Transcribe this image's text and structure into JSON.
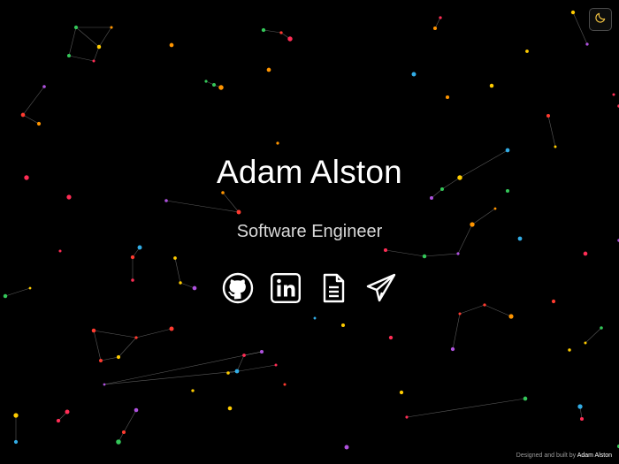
{
  "profile": {
    "name": "Adam Alston",
    "title": "Software Engineer"
  },
  "social_links": [
    {
      "icon": "github-icon",
      "label": "GitHub"
    },
    {
      "icon": "linkedin-icon",
      "label": "LinkedIn"
    },
    {
      "icon": "resume-document-icon",
      "label": "Resume"
    },
    {
      "icon": "paper-plane-icon",
      "label": "Contact"
    }
  ],
  "theme_toggle": {
    "icon": "moon-icon",
    "label": "Toggle theme",
    "accent_color": "#f5c542"
  },
  "footer": {
    "prefix": "Designed and built by",
    "author": "Adam Alston"
  },
  "background": {
    "color": "#000000",
    "particle_colors": [
      "#ff3b30",
      "#ff9500",
      "#ffcc00",
      "#34c759",
      "#32ade6",
      "#af52de",
      "#ff2d55"
    ]
  }
}
